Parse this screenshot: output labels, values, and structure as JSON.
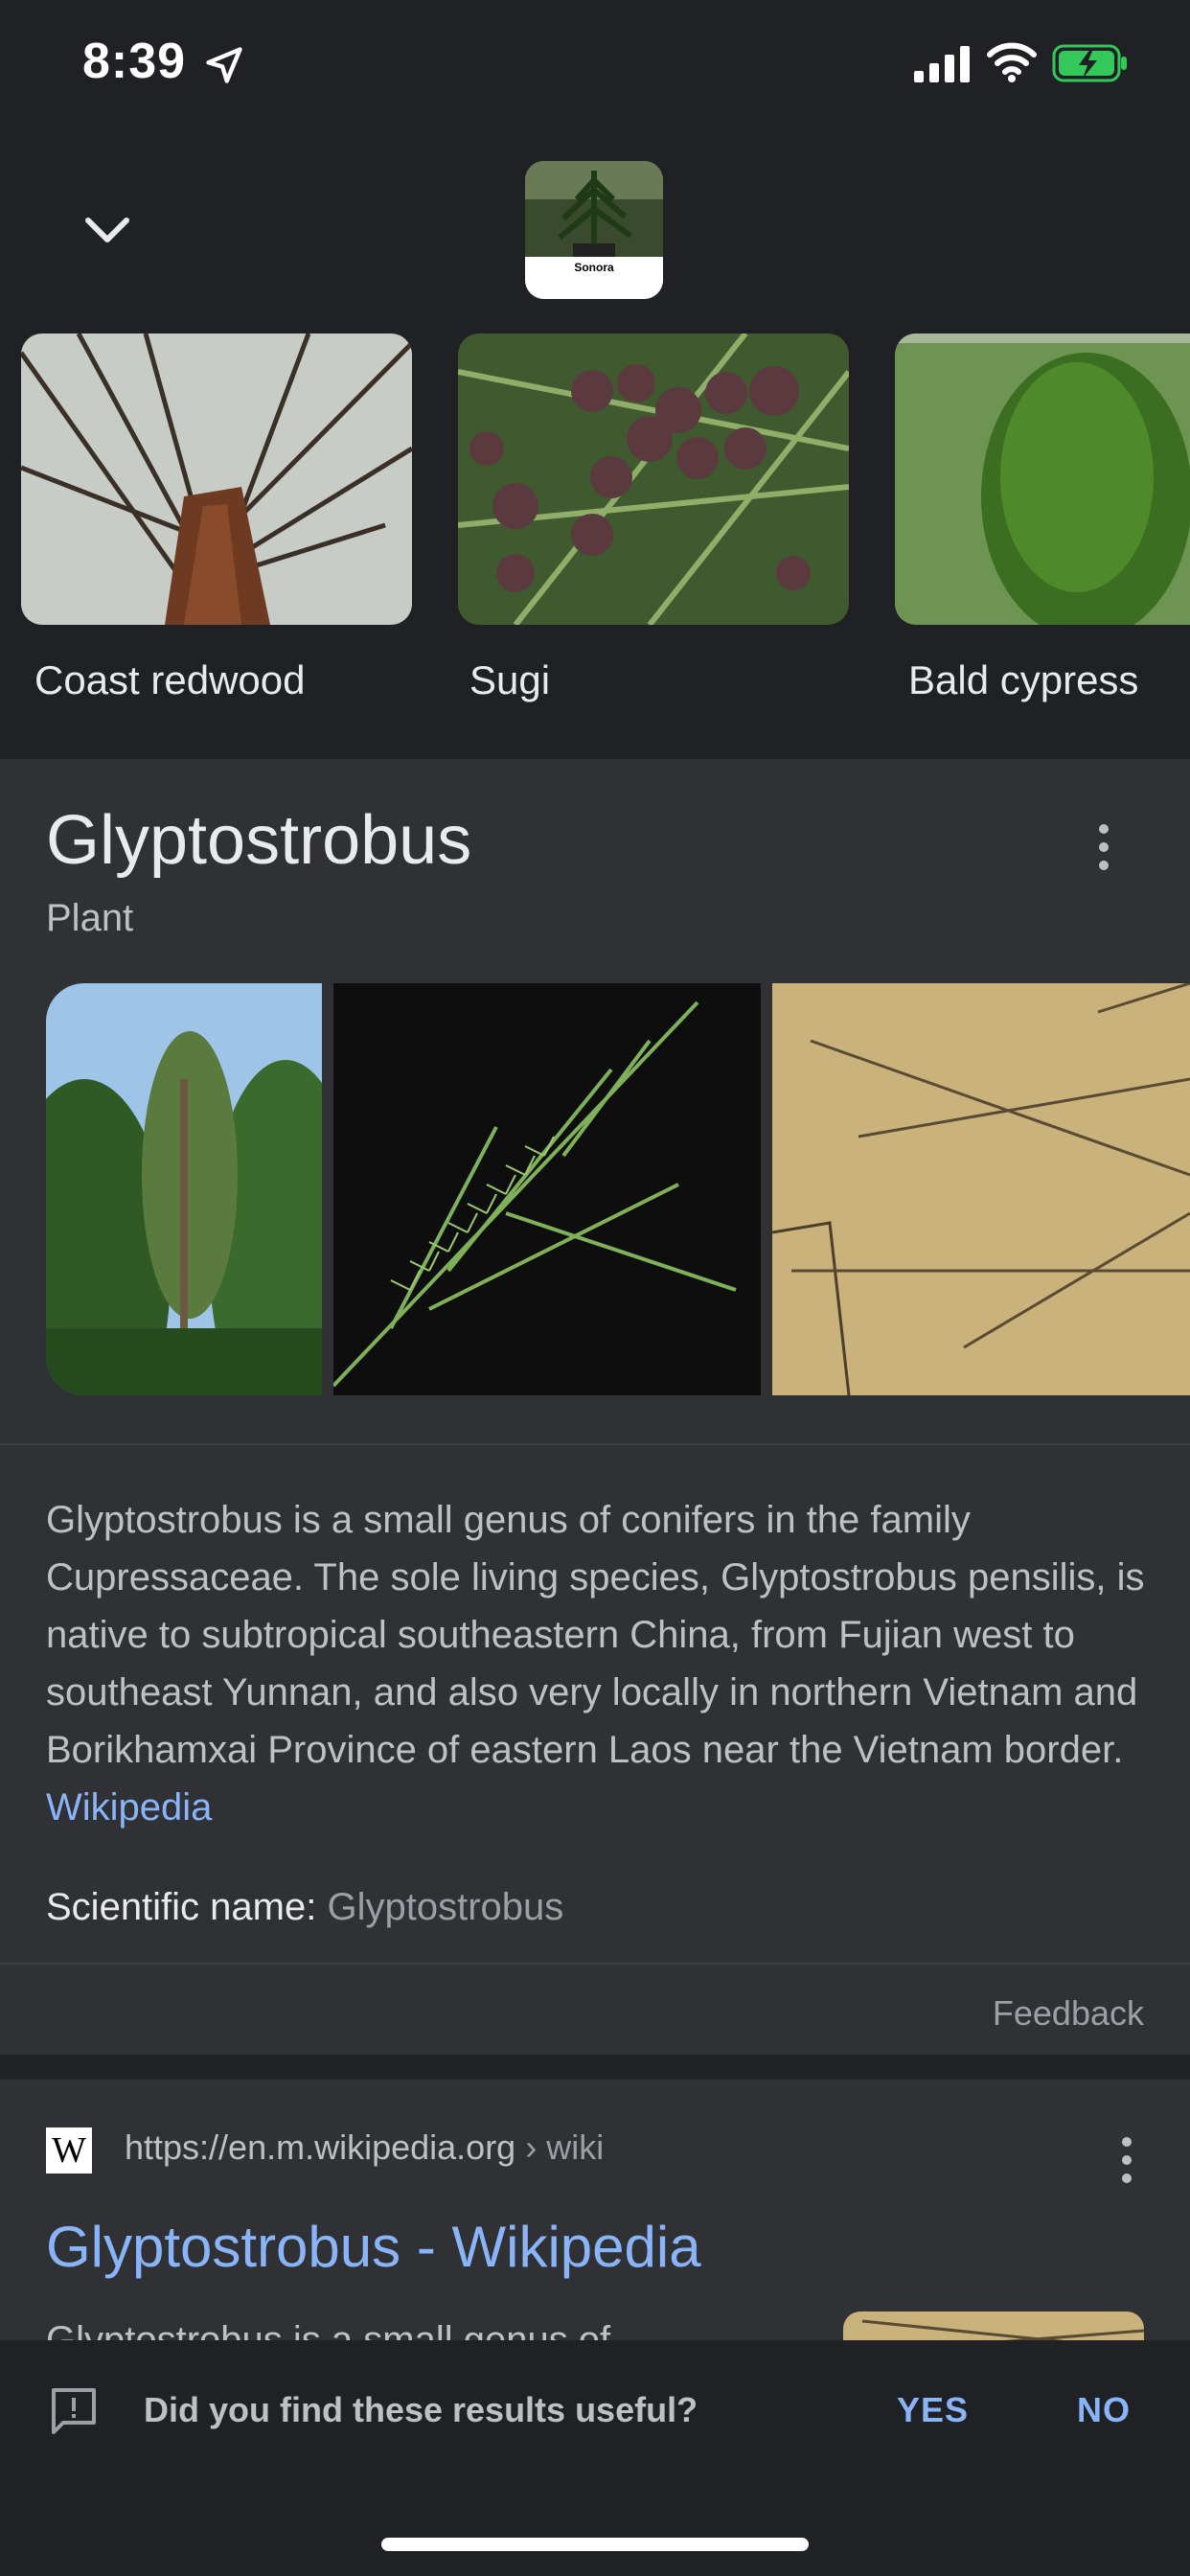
{
  "status": {
    "time": "8:39"
  },
  "similar": [
    {
      "label": "Coast redwood"
    },
    {
      "label": "Sugi"
    },
    {
      "label": "Bald cypress"
    }
  ],
  "query_thumb": {
    "caption": "Sonora"
  },
  "panel": {
    "title": "Glyptostrobus",
    "subtitle": "Plant",
    "description": "Glyptostrobus is a small genus of conifers in the family Cupressaceae. The sole living species, Glyptostrobus pensilis, is native to subtropical southeastern China, from Fujian west to southeast Yunnan, and also very locally in northern Vietnam and Borikhamxai Province of eastern Laos near the Vietnam border.",
    "source_link": "Wikipedia",
    "scientific_label": "Scientific name:",
    "scientific_value": "Glyptostrobus",
    "feedback": "Feedback"
  },
  "result": {
    "favicon": "W",
    "url": "https://en.m.wikipedia.org",
    "crumb": "› wiki",
    "title": "Glyptostrobus - Wikipedia",
    "snippet": "Glyptostrobus is a small genus of"
  },
  "prompt": {
    "question": "Did you find these results useful?",
    "yes": "YES",
    "no": "NO"
  },
  "colors": {
    "background": "#202124",
    "panel": "#303134",
    "link": "#8ab4f8"
  },
  "icons": [
    "location-arrow-icon",
    "signal-icon",
    "wifi-icon",
    "battery-charging-icon",
    "chevron-down-icon",
    "more-vert-icon",
    "wikipedia-favicon",
    "feedback-icon"
  ]
}
